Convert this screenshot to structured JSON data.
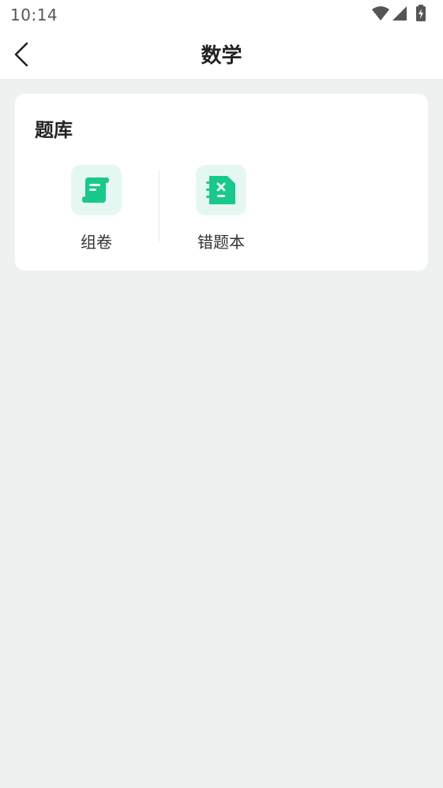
{
  "status_bar": {
    "time": "10:14",
    "icons": [
      "wifi-icon",
      "signal-icon",
      "battery-charging-icon"
    ]
  },
  "nav": {
    "back_icon": "chevron-left-icon",
    "title": "数学"
  },
  "question_bank": {
    "title": "题库",
    "items": [
      {
        "label": "组卷",
        "icon": "paper-scroll-icon"
      },
      {
        "label": "错题本",
        "icon": "wrong-notebook-icon"
      }
    ]
  },
  "colors": {
    "accent": "#19c98a",
    "icon_bg": "#e5f7f2",
    "page_bg": "#edf1f0",
    "card_bg": "#ffffff"
  }
}
